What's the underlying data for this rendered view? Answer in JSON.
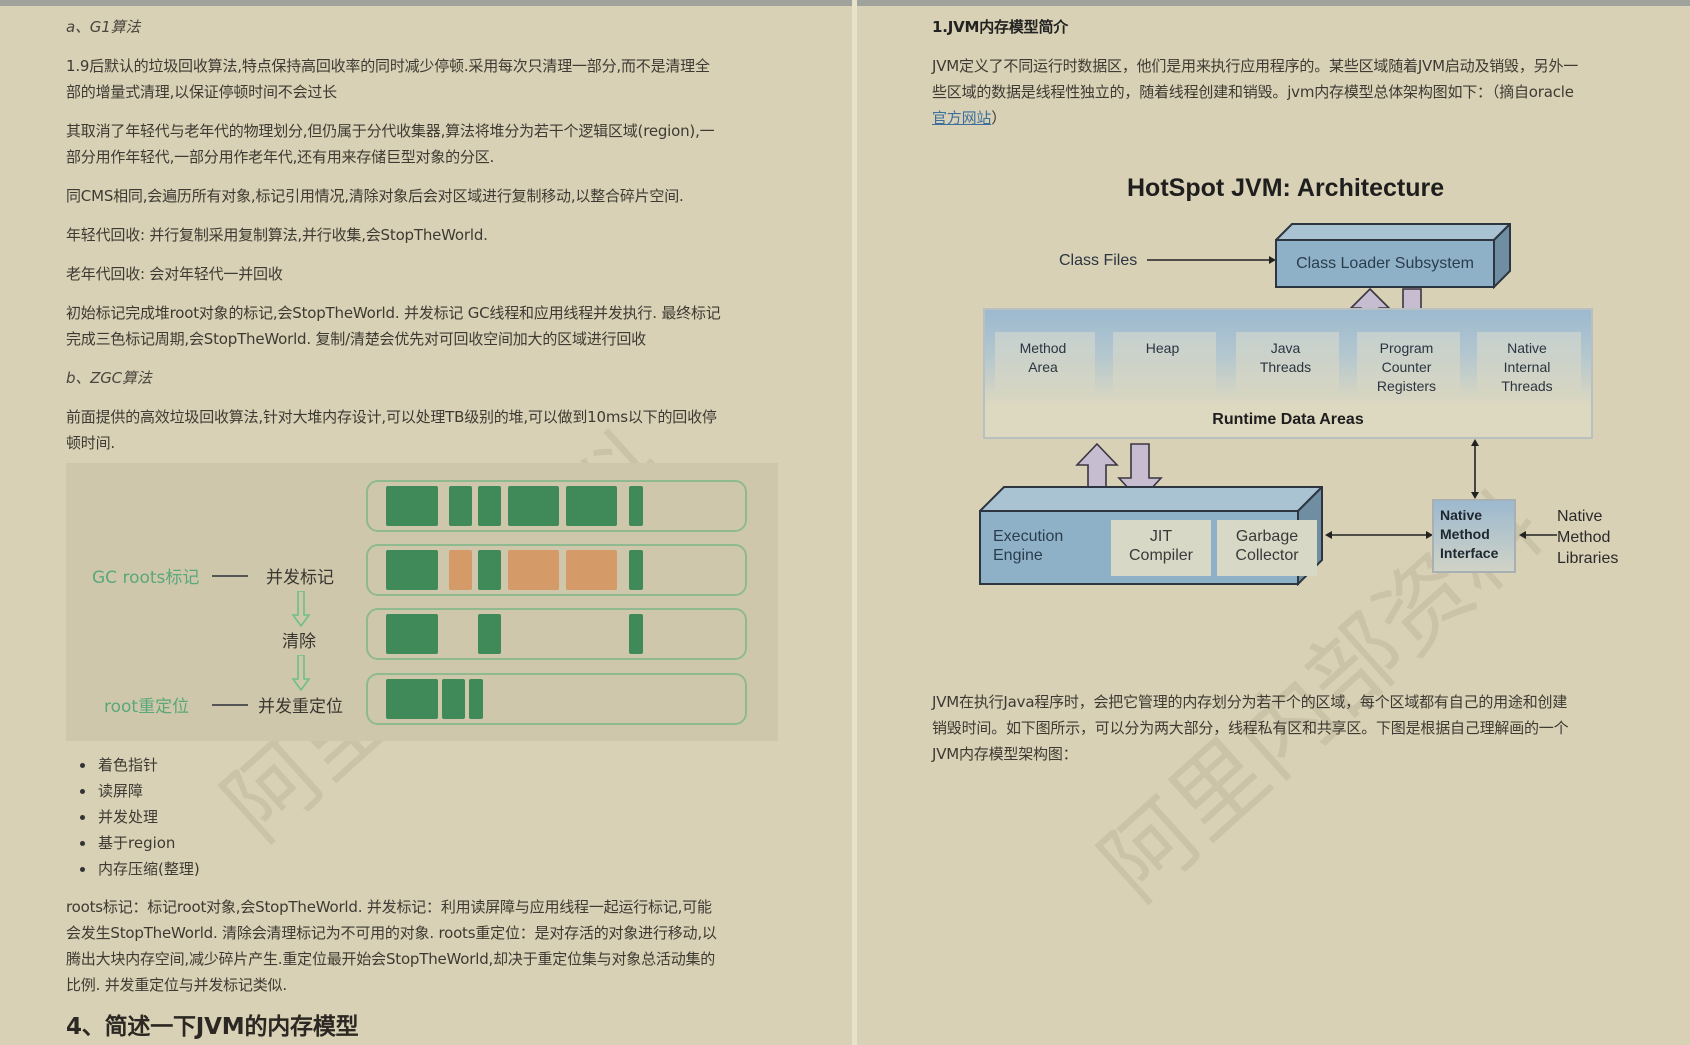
{
  "left_page": {
    "section_a_title": "a、G1算法",
    "p1": [
      "1.9后默认的垃圾回收算法,特点保持高回收率的同时减少停顿.采用每次只清理一部分,而不是清理全",
      "部的增量式清理,以保证停顿时间不会过长"
    ],
    "p2": [
      "其取消了年轻代与老年代的物理划分,但仍属于分代收集器,算法将堆分为若干个逻辑区域(region),一",
      "部分用作年轻代,一部分用作老年代,还有用来存储巨型对象的分区."
    ],
    "p3": "同CMS相同,会遍历所有对象,标记引用情况,清除对象后会对区域进行复制移动,以整合碎片空间.",
    "p4": "年轻代回收: 并行复制采用复制算法,并行收集,会StopTheWorld.",
    "p5": "老年代回收: 会对年轻代一并回收",
    "p6": [
      "初始标记完成堆root对象的标记,会StopTheWorld. 并发标记 GC线程和应用线程并发执行. 最终标记",
      "完成三色标记周期,会StopTheWorld. 复制/清楚会优先对可回收空间加大的区域进行回收"
    ],
    "section_b_title": "b、ZGC算法",
    "p7": [
      "前面提供的高效垃圾回收算法,针对大堆内存设计,可以处理TB级别的堆,可以做到10ms以下的回收停",
      "顿时间."
    ],
    "gc_figure": {
      "label_gc_roots": "GC roots标记",
      "label_concurrent_mark": "并发标记",
      "label_clear": "清除",
      "label_root_relocate": "root重定位",
      "label_concurrent_relocate": "并发重定位",
      "colors": {
        "live": "#3f8a58",
        "marked": "#d49a68"
      },
      "rows": [
        [
          "live",
          "live",
          "live",
          "live",
          "live",
          "live"
        ],
        [
          "live",
          "marked",
          "live",
          "marked",
          "marked",
          "live"
        ],
        [
          "live",
          "empty",
          "live",
          "empty",
          "empty",
          "live"
        ],
        [
          "live",
          "live",
          "live"
        ]
      ]
    },
    "bullets": [
      "着色指针",
      "读屏障",
      "并发处理",
      "基于region",
      "内存压缩(整理)"
    ],
    "p8": [
      "roots标记：标记root对象,会StopTheWorld. 并发标记：利用读屏障与应用线程一起运行标记,可能",
      "会发生StopTheWorld. 清除会清理标记为不可用的对象. roots重定位：是对存活的对象进行移动,以",
      "腾出大块内存空间,减少碎片产生.重定位最开始会StopTheWorld,却决于重定位集与对象总活动集的",
      "比例. 并发重定位与并发标记类似."
    ],
    "heading4": "4、简述一下JVM的内存模型"
  },
  "right_page": {
    "heading": "1.JVM内存模型简介",
    "intro": [
      "JVM定义了不同运行时数据区，他们是用来执行应用程序的。某些区域随着JVM启动及销毁，另外一",
      "些区域的数据是线程性独立的，随着线程创建和销毁。jvm内存模型总体架构图如下：（摘自oracle"
    ],
    "intro_link": "官方网站",
    "intro_tail": "）",
    "diagram": {
      "title": "HotSpot JVM: Architecture",
      "class_files": "Class Files",
      "class_loader": "Class Loader Subsystem",
      "runtime_areas": [
        "Method\nArea",
        "Heap",
        "Java\nThreads",
        "Program\nCounter\nRegisters",
        "Native\nInternal\nThreads"
      ],
      "runtime_title": "Runtime Data Areas",
      "execution_engine": "Execution\nEngine",
      "jit": "JIT\nCompiler",
      "gc": "Garbage\nCollector",
      "nmi": "Native\nMethod\nInterface",
      "nml": "Native\nMethod\nLibraries"
    },
    "para2": [
      "JVM在执行Java程序时，会把它管理的内存划分为若干个的区域，每个区域都有自己的用途和创建",
      "销毁时间。如下图所示，可以分为两大部分，线程私有区和共享区。下图是根据自己理解画的一个",
      "JVM内存模型架构图："
    ]
  },
  "watermark": "阿里内部资料"
}
